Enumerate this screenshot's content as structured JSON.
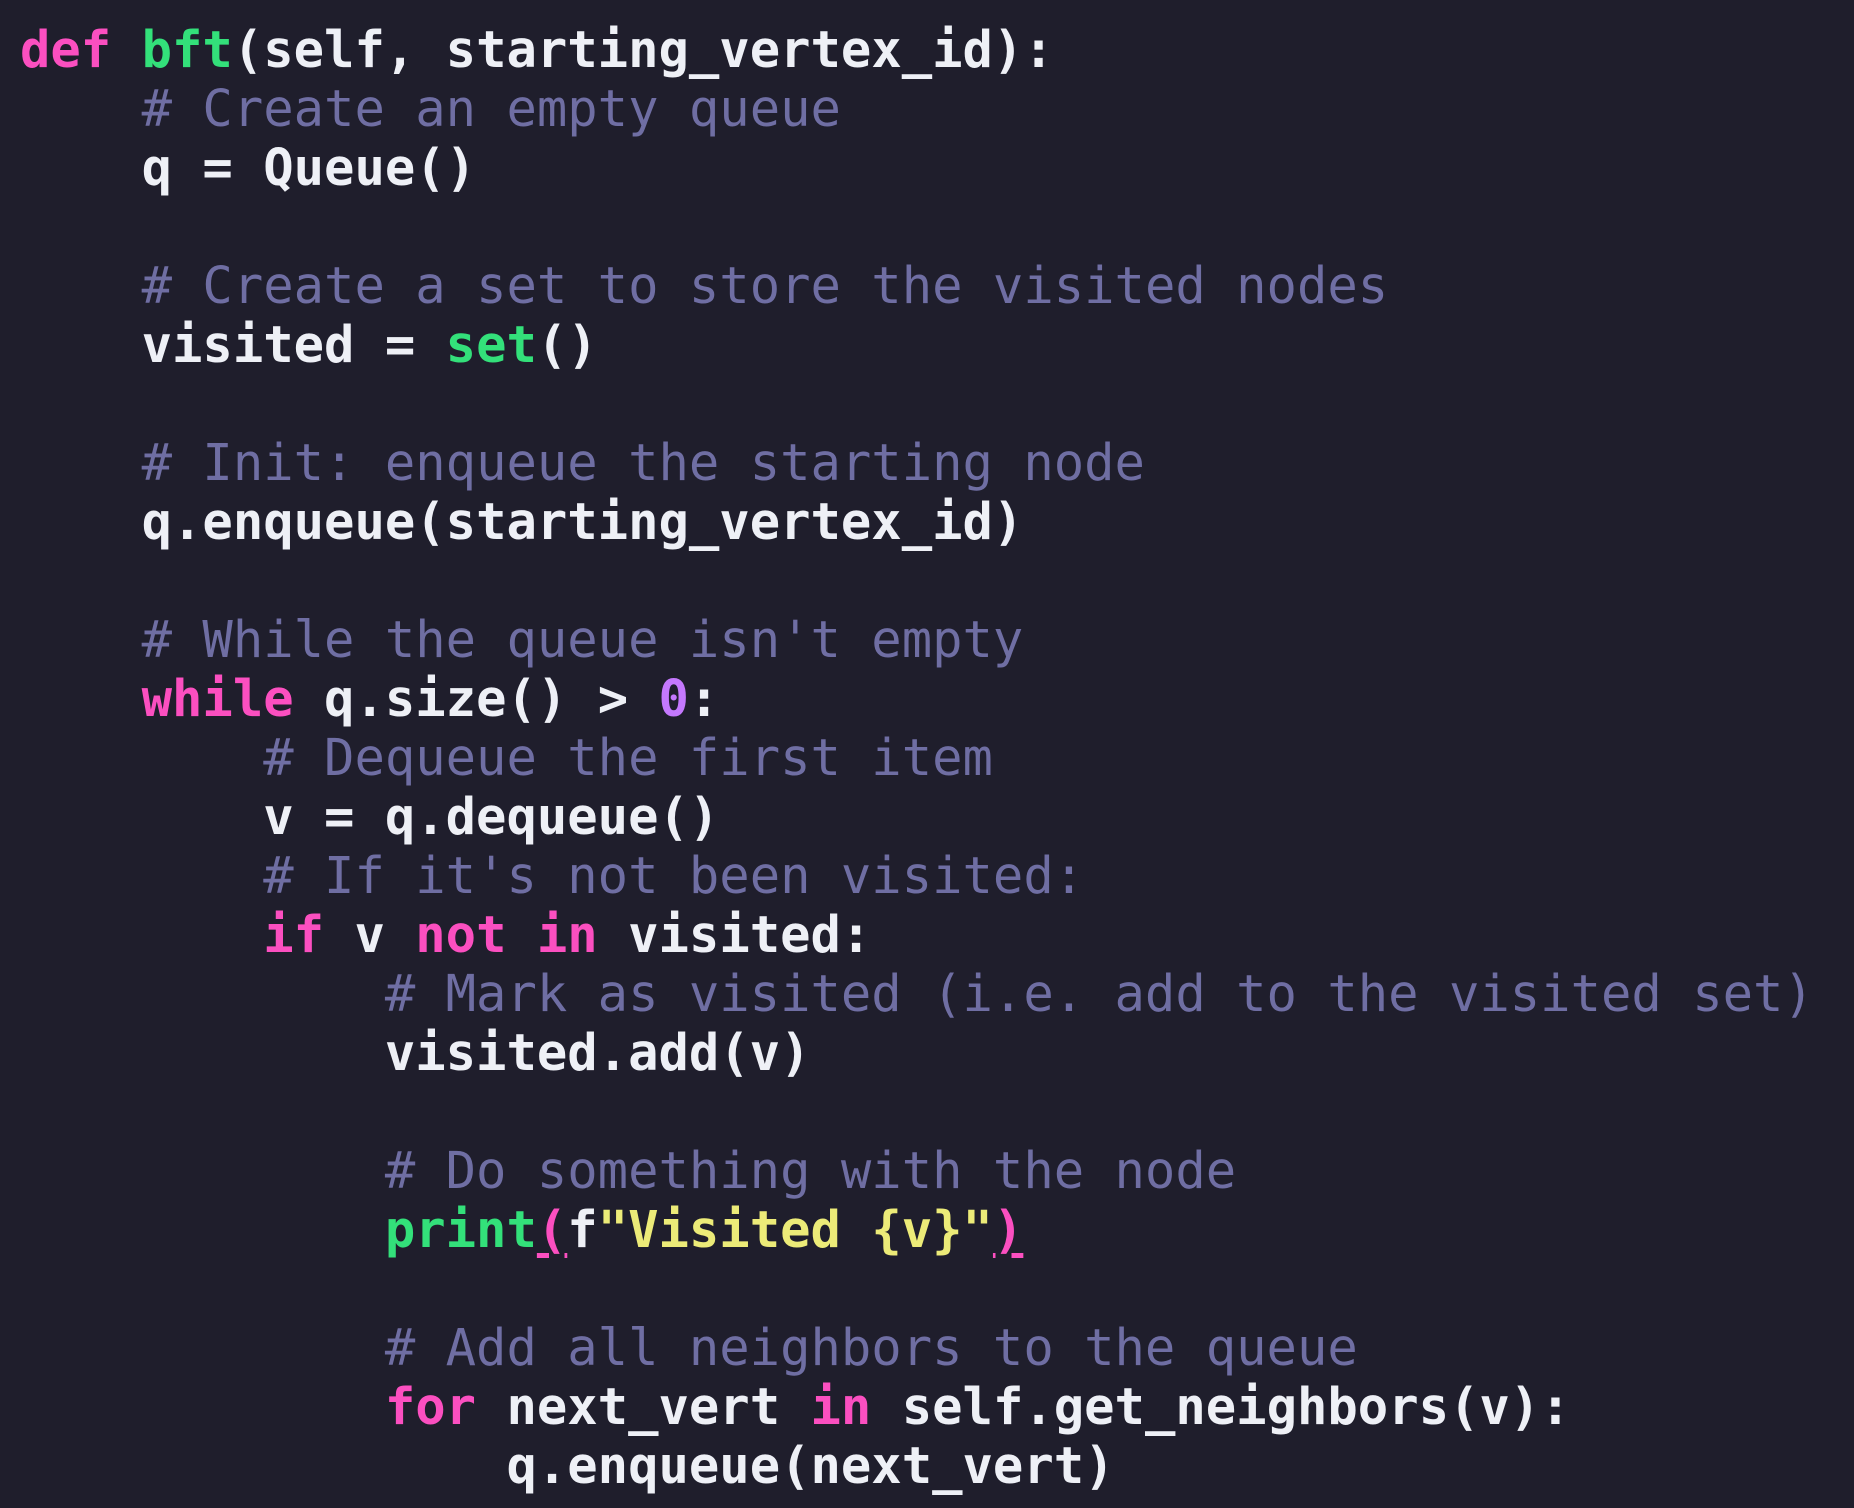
{
  "code": {
    "lines": [
      {
        "indent": "",
        "tokens": [
          {
            "t": "def",
            "k": "kw"
          },
          {
            "t": " "
          },
          {
            "t": "bft",
            "k": "fn"
          },
          {
            "t": "(self, starting_vertex_id):"
          }
        ]
      },
      {
        "indent": "    ",
        "tokens": [
          {
            "t": "# Create an empty queue",
            "k": "cm"
          }
        ]
      },
      {
        "indent": "    ",
        "tokens": [
          {
            "t": "q = Queue()"
          }
        ]
      },
      {
        "indent": "",
        "tokens": []
      },
      {
        "indent": "    ",
        "tokens": [
          {
            "t": "# Create a set to store the visited nodes",
            "k": "cm"
          }
        ]
      },
      {
        "indent": "    ",
        "tokens": [
          {
            "t": "visited = "
          },
          {
            "t": "set",
            "k": "fn"
          },
          {
            "t": "()"
          }
        ]
      },
      {
        "indent": "",
        "tokens": []
      },
      {
        "indent": "    ",
        "tokens": [
          {
            "t": "# Init: enqueue the starting node",
            "k": "cm"
          }
        ]
      },
      {
        "indent": "    ",
        "tokens": [
          {
            "t": "q.enqueue(starting_vertex_id)"
          }
        ]
      },
      {
        "indent": "",
        "tokens": []
      },
      {
        "indent": "    ",
        "tokens": [
          {
            "t": "# While the queue isn't empty",
            "k": "cm"
          }
        ]
      },
      {
        "indent": "    ",
        "tokens": [
          {
            "t": "while",
            "k": "kw"
          },
          {
            "t": " q.size() > "
          },
          {
            "t": "0",
            "k": "num"
          },
          {
            "t": ":"
          }
        ]
      },
      {
        "indent": "        ",
        "tokens": [
          {
            "t": "# Dequeue the first item",
            "k": "cm"
          }
        ]
      },
      {
        "indent": "        ",
        "tokens": [
          {
            "t": "v = q.dequeue()"
          }
        ]
      },
      {
        "indent": "        ",
        "tokens": [
          {
            "t": "# If it's not been visited:",
            "k": "cm"
          }
        ]
      },
      {
        "indent": "        ",
        "tokens": [
          {
            "t": "if",
            "k": "kw"
          },
          {
            "t": " v "
          },
          {
            "t": "not",
            "k": "kw"
          },
          {
            "t": " "
          },
          {
            "t": "in",
            "k": "kw"
          },
          {
            "t": " visited:"
          }
        ]
      },
      {
        "indent": "            ",
        "tokens": [
          {
            "t": "# Mark as visited (i.e. add to the visited set)",
            "k": "cm"
          }
        ]
      },
      {
        "indent": "            ",
        "tokens": [
          {
            "t": "visited.add(v)"
          }
        ]
      },
      {
        "indent": "",
        "tokens": []
      },
      {
        "indent": "            ",
        "tokens": [
          {
            "t": "# Do something with the node",
            "k": "cm"
          }
        ]
      },
      {
        "indent": "            ",
        "tokens": [
          {
            "t": "print",
            "k": "fn"
          },
          {
            "t": "(",
            "k": "paren-hl"
          },
          {
            "t": "f"
          },
          {
            "t": "\"Visited {v}\"",
            "k": "str"
          },
          {
            "t": ")",
            "k": "paren-hl"
          }
        ]
      },
      {
        "indent": "",
        "tokens": []
      },
      {
        "indent": "            ",
        "tokens": [
          {
            "t": "# Add all neighbors to the queue",
            "k": "cm"
          }
        ]
      },
      {
        "indent": "            ",
        "tokens": [
          {
            "t": "for",
            "k": "kw"
          },
          {
            "t": " next_vert "
          },
          {
            "t": "in",
            "k": "kw"
          },
          {
            "t": " self.get_neighbors(v):"
          }
        ]
      },
      {
        "indent": "                ",
        "tokens": [
          {
            "t": "q.enqueue(next_vert)"
          }
        ]
      }
    ]
  },
  "colors": {
    "background": "#1f1e2c",
    "keyword": "#fb4fc0",
    "function": "#33e07a",
    "comment": "#6f6ea3",
    "number": "#c478fd",
    "string": "#eceb78",
    "text": "#eef0f6"
  }
}
